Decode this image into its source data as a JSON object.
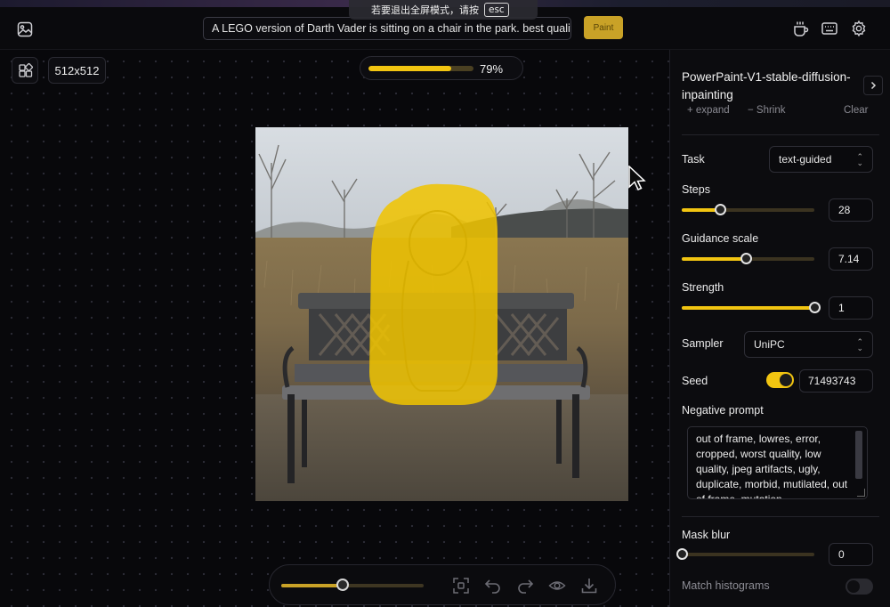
{
  "fullscreen_notice": {
    "text": "若要退出全屏模式，请按",
    "key": "esc"
  },
  "header": {
    "prompt_value": "A LEGO version of Darth Vader is sitting on a chair in the park. best quality",
    "paint_label": "Paint",
    "icons": [
      "image-icon",
      "coffee-icon",
      "keyboard-icon",
      "gear-icon"
    ]
  },
  "canvas": {
    "size_label": "512x512",
    "progress": {
      "percent": 79,
      "label": "79%"
    },
    "brush_size_fraction": 0.43
  },
  "panel": {
    "title": "PowerPaint-V1-stable-diffusion-inpainting",
    "hidden_buttons": {
      "expand": "+ expand",
      "shrink": "− Shrink",
      "clear": "Clear"
    },
    "task": {
      "label": "Task",
      "value": "text-guided"
    },
    "steps": {
      "label": "Steps",
      "value": "28",
      "fraction": 0.29
    },
    "guidance": {
      "label": "Guidance scale",
      "value": "7.14",
      "fraction": 0.48
    },
    "strength": {
      "label": "Strength",
      "value": "1",
      "fraction": 1.0
    },
    "sampler": {
      "label": "Sampler",
      "value": "UniPC"
    },
    "seed": {
      "label": "Seed",
      "value": "71493743",
      "enabled": true
    },
    "negative_prompt": {
      "label": "Negative prompt",
      "value": "out of frame, lowres, error, cropped, worst quality, low quality, jpeg artifacts, ugly, duplicate, morbid, mutilated, out of frame, mutation"
    },
    "mask_blur": {
      "label": "Mask blur",
      "value": "0",
      "fraction": 0.0
    },
    "match_histograms": {
      "label": "Match histograms",
      "enabled": false
    }
  },
  "colors": {
    "accent": "#f2c511",
    "background": "#07070a",
    "panel": "#0c0c0f"
  }
}
